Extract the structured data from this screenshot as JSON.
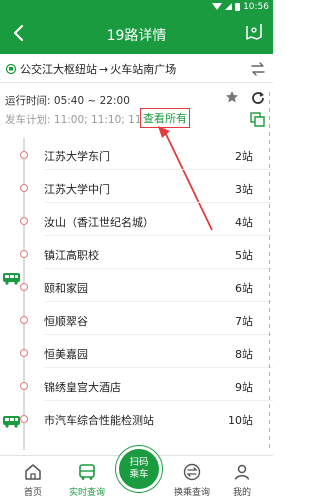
{
  "status_bar": {
    "time": "10:56"
  },
  "header": {
    "title": "19路详情"
  },
  "route": {
    "from": "公交江大枢纽站",
    "arrow": "→",
    "to": "火车站南广场"
  },
  "schedule": {
    "operating_time_label": "运行时间:",
    "operating_time": "05:40 ~ 22:00",
    "plan_label": "发车计划:",
    "plan_times": "11:00; 11:10; 11:20;",
    "view_all": "查看所有"
  },
  "stops": [
    {
      "name": "江苏大学东门",
      "count": "2站"
    },
    {
      "name": "江苏大学中门",
      "count": "3站"
    },
    {
      "name": "汝山（香江世纪名城）",
      "count": "4站"
    },
    {
      "name": "镇江高职校",
      "count": "5站"
    },
    {
      "name": "颐和家园",
      "count": "6站"
    },
    {
      "name": "恒顺翠谷",
      "count": "7站"
    },
    {
      "name": "恒美嘉园",
      "count": "8站"
    },
    {
      "name": "锦绣皇宫大酒店",
      "count": "9站"
    },
    {
      "name": "市汽车综合性能检测站",
      "count": "10站"
    }
  ],
  "tabs": {
    "home": "首页",
    "realtime": "实时查询",
    "scan_line1": "扫码",
    "scan_line2": "乘车",
    "transfer": "换乘查询",
    "mine": "我的"
  },
  "colors": {
    "brand": "#1a9b3f",
    "highlight": "#e23b3b"
  }
}
